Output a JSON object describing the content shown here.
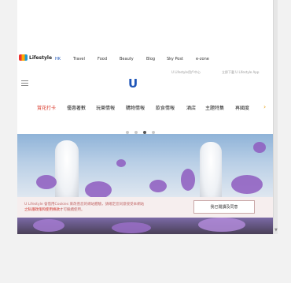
{
  "site": {
    "logo_text": "Lifestyle"
  },
  "top_nav": {
    "items": [
      {
        "label": "HK",
        "active": true
      },
      {
        "label": "Travel"
      },
      {
        "label": "Food"
      },
      {
        "label": "Beauty"
      },
      {
        "label": "Blog"
      },
      {
        "label": "Sky Post"
      },
      {
        "label": "e-zone"
      }
    ]
  },
  "user_links": {
    "member_center": "U Lifestyle用戶中心",
    "download_app": "立即下載 U Lifestyle App"
  },
  "brand": {
    "mark": "U"
  },
  "categories": {
    "items": [
      {
        "label": "賞花打卡",
        "active": true
      },
      {
        "label": "優惠著數"
      },
      {
        "label": "玩樂情報"
      },
      {
        "label": "購物情報"
      },
      {
        "label": "飲食情報"
      },
      {
        "label": "酒店"
      },
      {
        "label": "主題特集"
      },
      {
        "label": "再國度"
      }
    ],
    "next_arrow": "›"
  },
  "carousel": {
    "total": 4,
    "active_index": 2
  },
  "cookie_notice": {
    "line1": "U Lifestyle 會借用Cookies 來改善您的網站體驗，請確定您同意接受本網站",
    "line2_link": "之私隱政策和使用條款",
    "line2_rest": "才可繼續使用。",
    "accept_label": "我已閱讀及同意"
  },
  "colors": {
    "accent": "#1f56b8",
    "highlight": "#d93a2b",
    "arrow": "#e8a21a"
  }
}
